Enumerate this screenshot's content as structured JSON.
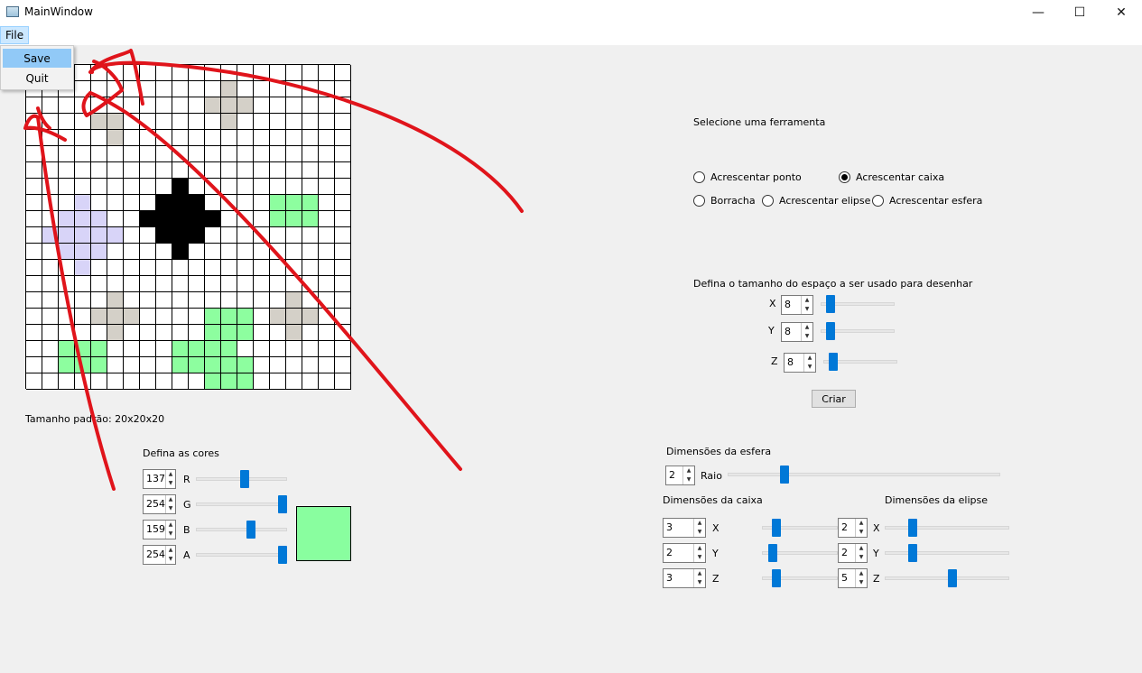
{
  "window": {
    "title": "MainWindow",
    "minimize_glyph": "—",
    "maximize_glyph": "☐",
    "close_glyph": "✕"
  },
  "menu": {
    "file_label": "File",
    "items": [
      {
        "label": "Save"
      },
      {
        "label": "Quit"
      }
    ]
  },
  "canvas": {
    "cols": 20,
    "rows": 20,
    "palette": {
      "1": "#d4d0c8",
      "2": "#d8d4f8",
      "3": "#000000",
      "4": "#8dfe9f"
    },
    "grid": [
      "00000000000000000000",
      "00000000000000000000",
      "00000000000000000000",
      "00000000000000000000",
      "00000000000000000000",
      "00000000000000000000",
      "00000000000000000000",
      "00000000000000000000",
      "00000000000000000000",
      "00000000000000000000",
      "00000000000000000000",
      "00000000000000000000",
      "00000000000000000000",
      "00000000000000000000",
      "00000000000000000000",
      "00000000000000000000",
      "00000000000000000000",
      "00000000000000000000",
      "00000000000000000000",
      "00000000000000000000"
    ],
    "filled_cells": [
      [
        1,
        12,
        1
      ],
      [
        2,
        11,
        1
      ],
      [
        2,
        12,
        1
      ],
      [
        2,
        13,
        1
      ],
      [
        3,
        12,
        1
      ],
      [
        3,
        4,
        1
      ],
      [
        3,
        5,
        1
      ],
      [
        4,
        5,
        1
      ],
      [
        7,
        9,
        3
      ],
      [
        8,
        8,
        3
      ],
      [
        8,
        9,
        3
      ],
      [
        8,
        10,
        3
      ],
      [
        9,
        7,
        3
      ],
      [
        9,
        8,
        3
      ],
      [
        9,
        9,
        3
      ],
      [
        9,
        10,
        3
      ],
      [
        9,
        11,
        3
      ],
      [
        10,
        8,
        3
      ],
      [
        10,
        9,
        3
      ],
      [
        10,
        10,
        3
      ],
      [
        11,
        9,
        3
      ],
      [
        8,
        3,
        2
      ],
      [
        9,
        2,
        2
      ],
      [
        9,
        3,
        2
      ],
      [
        9,
        4,
        2
      ],
      [
        10,
        1,
        2
      ],
      [
        10,
        2,
        2
      ],
      [
        10,
        3,
        2
      ],
      [
        10,
        4,
        2
      ],
      [
        10,
        5,
        2
      ],
      [
        11,
        2,
        2
      ],
      [
        11,
        3,
        2
      ],
      [
        11,
        4,
        2
      ],
      [
        12,
        3,
        2
      ],
      [
        8,
        15,
        4
      ],
      [
        8,
        16,
        4
      ],
      [
        8,
        17,
        4
      ],
      [
        9,
        15,
        4
      ],
      [
        9,
        16,
        4
      ],
      [
        9,
        17,
        4
      ],
      [
        14,
        5,
        1
      ],
      [
        15,
        4,
        1
      ],
      [
        15,
        5,
        1
      ],
      [
        15,
        6,
        1
      ],
      [
        16,
        5,
        1
      ],
      [
        14,
        16,
        1
      ],
      [
        15,
        15,
        1
      ],
      [
        15,
        16,
        1
      ],
      [
        15,
        17,
        1
      ],
      [
        16,
        16,
        1
      ],
      [
        15,
        11,
        4
      ],
      [
        15,
        12,
        4
      ],
      [
        15,
        13,
        4
      ],
      [
        16,
        11,
        4
      ],
      [
        16,
        12,
        4
      ],
      [
        16,
        13,
        4
      ],
      [
        17,
        11,
        4
      ],
      [
        17,
        12,
        4
      ],
      [
        17,
        9,
        4
      ],
      [
        17,
        10,
        4
      ],
      [
        18,
        9,
        4
      ],
      [
        18,
        10,
        4
      ],
      [
        18,
        11,
        4
      ],
      [
        18,
        12,
        4
      ],
      [
        18,
        13,
        4
      ],
      [
        19,
        11,
        4
      ],
      [
        19,
        12,
        4
      ],
      [
        19,
        13,
        4
      ],
      [
        17,
        2,
        4
      ],
      [
        17,
        3,
        4
      ],
      [
        17,
        4,
        4
      ],
      [
        18,
        2,
        4
      ],
      [
        18,
        3,
        4
      ],
      [
        18,
        4,
        4
      ]
    ]
  },
  "default_size_label": "Tamanho padrão: 20x20x20",
  "colors_section": {
    "title": "Defina as cores",
    "rows": [
      {
        "value": "137",
        "label": "R",
        "level": 0.54
      },
      {
        "value": "254",
        "label": "G",
        "level": 1.0
      },
      {
        "value": "159",
        "label": "B",
        "level": 0.62
      },
      {
        "value": "254",
        "label": "A",
        "level": 1.0
      }
    ],
    "preview_color": "#89fe9f"
  },
  "tools": {
    "title": "Selecione uma ferramenta",
    "options": [
      {
        "label": "Acrescentar ponto",
        "checked": false
      },
      {
        "label": "Acrescentar caixa",
        "checked": true
      },
      {
        "label": "Borracha",
        "checked": false
      },
      {
        "label": "Acrescentar elipse",
        "checked": false
      },
      {
        "label": "Acrescentar esfera",
        "checked": false
      }
    ]
  },
  "space": {
    "title": "Defina o tamanho do espaço a ser usado para desenhar",
    "axes": [
      {
        "label": "X",
        "value": "8",
        "level": 0.08
      },
      {
        "label": "Y",
        "value": "8",
        "level": 0.08
      },
      {
        "label": "Z",
        "value": "8",
        "level": 0.08
      }
    ],
    "create_label": "Criar"
  },
  "sphere": {
    "title": "Dimensões da esfera",
    "value": "2",
    "label": "Raio",
    "level": 0.2
  },
  "box": {
    "title": "Dimensões da caixa",
    "axes": [
      {
        "label": "X",
        "value": "3",
        "level": 0.15
      },
      {
        "label": "Y",
        "value": "2",
        "level": 0.1
      },
      {
        "label": "Z",
        "value": "3",
        "level": 0.15
      }
    ]
  },
  "ellipse": {
    "title": "Dimensões da elipse",
    "axes": [
      {
        "label": "X",
        "value": "2",
        "level": 0.2
      },
      {
        "label": "Y",
        "value": "2",
        "level": 0.2
      },
      {
        "label": "Z",
        "value": "5",
        "level": 0.55
      }
    ]
  }
}
